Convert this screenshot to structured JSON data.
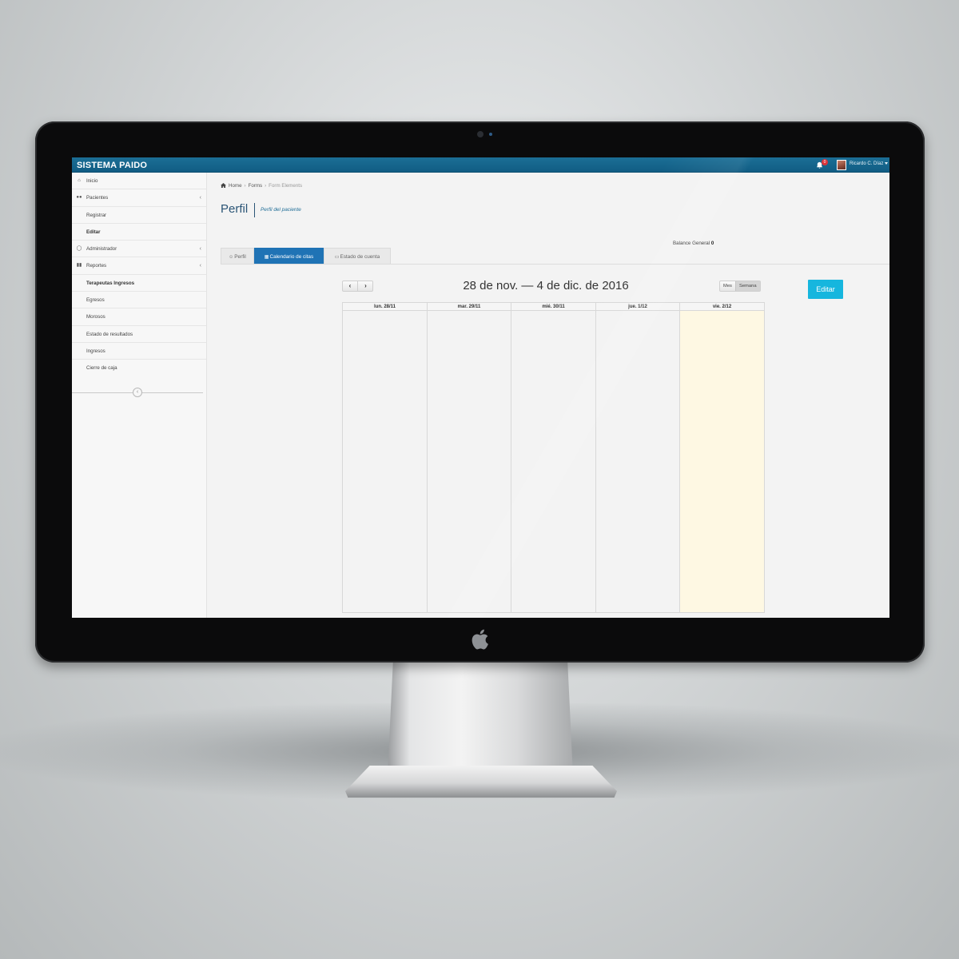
{
  "app": {
    "brand": "SISTEMA PAIDO",
    "notifications_count": "0",
    "user_name": "Ricardo C. Díaz"
  },
  "sidebar": {
    "items": [
      {
        "label": "Inicio",
        "icon": "home-icon",
        "has_children": false
      },
      {
        "label": "Pacientes",
        "icon": "users-icon",
        "has_children": true
      },
      {
        "label": "Registrar",
        "icon": "",
        "has_children": false
      },
      {
        "label": "Editar",
        "icon": "",
        "has_children": false
      },
      {
        "label": "Administrador",
        "icon": "unlock-icon",
        "has_children": true
      },
      {
        "label": "Reportes",
        "icon": "bar-chart-icon",
        "has_children": true
      },
      {
        "label": "Terapeutas Ingresos",
        "icon": "",
        "has_children": false
      },
      {
        "label": "Egresos",
        "icon": "",
        "has_children": false
      },
      {
        "label": "Morosos",
        "icon": "",
        "has_children": false
      },
      {
        "label": "Estado de resultados",
        "icon": "",
        "has_children": false
      },
      {
        "label": "Ingresos",
        "icon": "",
        "has_children": false
      },
      {
        "label": "Cierre de caja",
        "icon": "",
        "has_children": false
      }
    ],
    "collapse_icon": "chevron-left-icon"
  },
  "breadcrumb": [
    "Home",
    "Forms",
    "Form Elements"
  ],
  "page": {
    "title": "Perfil",
    "subtitle": "Perfil del paciente",
    "balance_label": "Balance General",
    "balance_value": "0"
  },
  "tabs": [
    {
      "label": "Perfil",
      "icon": "user-icon",
      "active": false
    },
    {
      "label": "Calendario de citas",
      "icon": "calendar-icon",
      "active": true
    },
    {
      "label": "Estado de cuenta",
      "icon": "credit-card-icon",
      "active": false
    }
  ],
  "calendar": {
    "title": "28 de nov. — 4 de dic. de 2016",
    "prev_label": "‹",
    "next_label": "›",
    "views": [
      {
        "label": "Mes",
        "active": false
      },
      {
        "label": "Semana",
        "active": true
      }
    ],
    "days": [
      "lun. 28/11",
      "mar. 29/11",
      "mié. 30/11",
      "jue. 1/12",
      "vie. 2/12"
    ],
    "highlight_day": "vie. 2/12"
  },
  "actions": {
    "edit_label": "Editar"
  },
  "colors": {
    "topbar": "#115d84",
    "active_tab": "#1f73b5",
    "edit_button": "#16b6de",
    "today_column": "#fef8e3"
  }
}
